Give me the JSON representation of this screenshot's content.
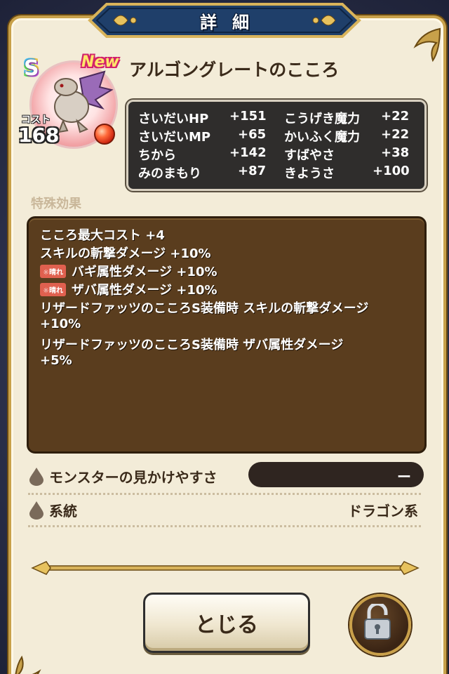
{
  "header": {
    "title": "詳細"
  },
  "monster": {
    "rank": "S",
    "badge": "New",
    "name": "アルゴングレートのこころ",
    "cost_label": "コスト",
    "cost": "168"
  },
  "stats": [
    {
      "name": "さいだいHP",
      "value": "+151"
    },
    {
      "name": "こうげき魔力",
      "value": "+22"
    },
    {
      "name": "さいだいMP",
      "value": "+65"
    },
    {
      "name": "かいふく魔力",
      "value": "+22"
    },
    {
      "name": "ちから",
      "value": "+142"
    },
    {
      "name": "すばやさ",
      "value": "+38"
    },
    {
      "name": "みのまもり",
      "value": "+87"
    },
    {
      "name": "きようさ",
      "value": "+100"
    }
  ],
  "effects": {
    "label": "特殊効果",
    "weather_tag": "☼晴れ",
    "lines": [
      "こころ最大コスト +4",
      "スキルの斬撃ダメージ +10%",
      "バギ属性ダメージ +10%",
      "ザバ属性ダメージ +10%",
      "リザードファッツのこころS装備時 スキルの斬撃ダメージ",
      "+10%",
      "リザードファッツのこころS装備時 ザバ属性ダメージ",
      "+5%"
    ]
  },
  "info": {
    "visibility_label": "モンスターの見かけやすさ",
    "visibility_value": "ー",
    "lineage_label": "系統",
    "lineage_value": "ドラゴン系"
  },
  "buttons": {
    "close": "とじる",
    "lock_icon": "lock-open-icon"
  },
  "colors": {
    "panel": "#f3ecd8",
    "stats_bg": "#2f2d2c",
    "effects_bg": "#5a3d1e",
    "banner": "#1f3f6a",
    "gold": "#c8a14a"
  }
}
